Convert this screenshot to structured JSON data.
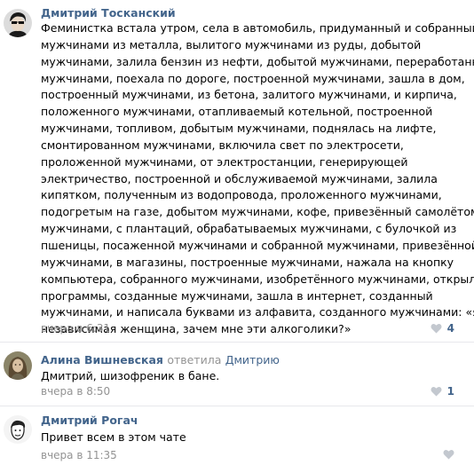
{
  "comments": [
    {
      "author": "Дмитрий Тосканский",
      "reply_label": "",
      "reply_to": "",
      "text_lines": [
        "Феминистка встала утром, села в автомобиль, придуманный и собранный",
        "мужчинами из металла, вылитого мужчинами из руды, добытой",
        "мужчинами, залила бензин из нефти, добытой мужчинами, переработанной",
        "мужчинами, поехала по дороге, построенной мужчинами, зашла в дом,",
        "построенный мужчинами, из бетона, залитого мужчинами, и кирпича,",
        "положенного мужчинами, отапливаемый котельной, построенной",
        "мужчинами, топливом, добытым мужчинами, поднялась на лифте,",
        "смонтированном мужчинами, включила свет по электросети,",
        "проложенной мужчинами, от электростанции, генерирующей",
        "электричество, построенной и обслуживаемой мужчинами, залила",
        "кипятком, полученным из водопровода, проложенного мужчинами,",
        "подогретым на газе, добытом мужчинами, кофе, привезённый самолётом",
        "мужчинами, с плантаций, обрабатываемых мужчинами, с булочкой из",
        "пшеницы, посаженной мужчинами и собранной мужчинами, привезённой",
        "мужчинами, в магазины, построенные мужчинами, нажала на кнопку",
        "компьютера, собранного мужчинами, изобретённого мужчинами, открыла",
        "программы, созданные мужчинами, зашла в интернет, созданный",
        "мужчинами, и написала буквами из алфавита, созданного мужчинами: «я",
        "независимая женщина, зачем мне эти алкоголики?»"
      ],
      "time": "вчера в 6:31",
      "likes": "4"
    },
    {
      "author": "Алина Вишневская",
      "reply_label": "ответила",
      "reply_to": "Дмитрию",
      "text_lines": [
        "Дмитрий, шизофреник в бане."
      ],
      "time": "вчера в 8:50",
      "likes": "1"
    },
    {
      "author": "Дмитрий Рогач",
      "reply_label": "",
      "reply_to": "",
      "text_lines": [
        "Привет всем в этом чате"
      ],
      "time": "вчера в 11:35",
      "likes": ""
    }
  ],
  "colors": {
    "link": "#42648b",
    "meta": "#939393",
    "divider": "#e7e8ec"
  },
  "icons": {
    "like": "heart-icon"
  }
}
